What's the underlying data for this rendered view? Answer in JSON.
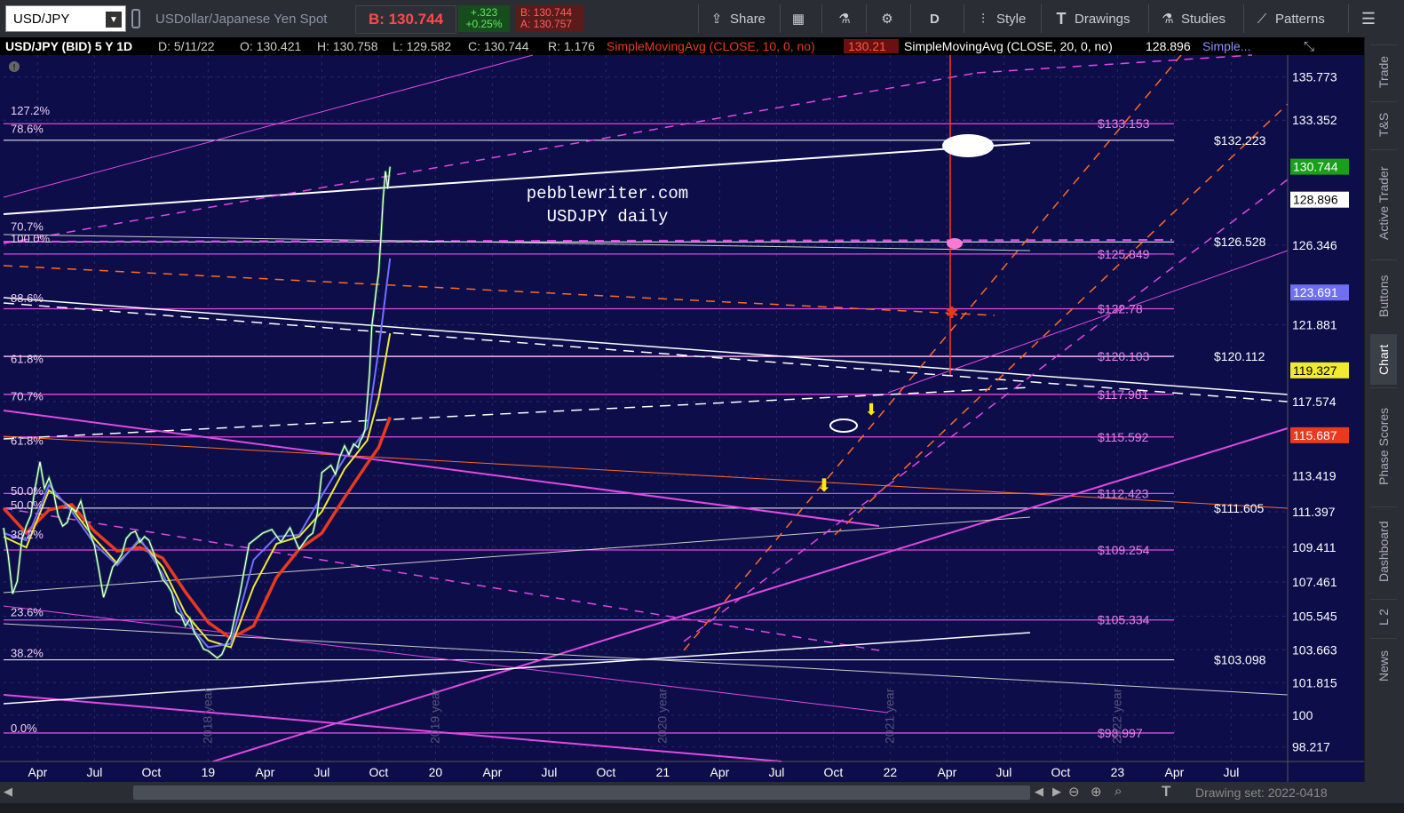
{
  "toolbar": {
    "symbol": "USD/JPY",
    "description": "USDollar/Japanese Yen Spot",
    "bid": "B: 130.744",
    "change_abs": "+.323",
    "change_pct": "+0.25%",
    "bid_small": "B: 130.744",
    "ask_small": "A: 130.757",
    "share": "Share",
    "aggregation": "D",
    "style": "Style",
    "drawings": "Drawings",
    "studies": "Studies",
    "patterns": "Patterns"
  },
  "header": {
    "title": "USD/JPY (BID) 5 Y 1D",
    "date": "D: 5/11/22",
    "open": "O: 130.421",
    "high": "H: 130.758",
    "low": "L: 129.582",
    "close": "C: 130.744",
    "range": "R: 1.176",
    "sma10": "SimpleMovingAvg (CLOSE, 10, 0, no)",
    "sma10_val": "130.21",
    "sma20": "SimpleMovingAvg (CLOSE, 20, 0, no)",
    "sma20_val": "128.896",
    "more": "Simple..."
  },
  "watermark": [
    "pebblewriter.com",
    "USDJPY daily"
  ],
  "side_tabs": [
    "Trade",
    "T&S",
    "Active Trader",
    "Buttons",
    "Chart",
    "Phase Scores",
    "Dashboard",
    "L 2",
    "News"
  ],
  "scrollbar": {
    "drawing_set": "Drawing set: 2022-0418"
  },
  "chart_data": {
    "type": "line",
    "title": "USDJPY daily",
    "ylim": [
      97.4,
      137.0
    ],
    "grid": true,
    "y_ticks": [
      "135.773",
      "133.352",
      "126.346",
      "121.881",
      "117.574",
      "113.419",
      "111.397",
      "109.411",
      "107.461",
      "105.545",
      "103.663",
      "101.815",
      "100",
      "98.217"
    ],
    "x_ticks": [
      "Apr",
      "Jul",
      "Oct",
      "19",
      "Apr",
      "Jul",
      "Oct",
      "20",
      "Apr",
      "Jul",
      "Oct",
      "21",
      "Apr",
      "Jul",
      "Oct",
      "22",
      "Apr",
      "Jul",
      "Oct",
      "23",
      "Apr",
      "Jul"
    ],
    "year_markers": [
      "2018 year",
      "2019 year",
      "2020 year",
      "2021 year",
      "2022 year"
    ],
    "price_badges": [
      {
        "value": "130.744",
        "color": "#18a018"
      },
      {
        "value": "128.896",
        "color": "#ffffff"
      },
      {
        "value": "123.691",
        "color": "#6f6ff0"
      },
      {
        "value": "119.327",
        "color": "#f0ea30"
      },
      {
        "value": "115.687",
        "color": "#e83a1e"
      }
    ],
    "fib_left_labels": [
      {
        "text": "127.2%",
        "price": 133.9
      },
      {
        "text": "78.6%",
        "price": 132.9
      },
      {
        "text": "70.7%",
        "price": 127.4
      },
      {
        "text": "100.0%",
        "price": 126.75
      },
      {
        "text": "88.6%",
        "price": 123.4
      },
      {
        "text": "61.8%",
        "price": 120.0
      },
      {
        "text": "70.7%",
        "price": 117.9
      },
      {
        "text": "61.8%",
        "price": 115.4
      },
      {
        "text": "50.0%",
        "price": 112.6
      },
      {
        "text": "50.0%",
        "price": 111.8
      },
      {
        "text": "38.2%",
        "price": 110.15
      },
      {
        "text": "23.6%",
        "price": 105.8
      },
      {
        "text": "38.2%",
        "price": 103.5
      },
      {
        "text": "0.0%",
        "price": 99.3
      }
    ],
    "levels": [
      {
        "price": 133.153,
        "label": "$133.153",
        "color": "#e04ae0"
      },
      {
        "price": 132.223,
        "label": "$132.223",
        "color": "#ffffff"
      },
      {
        "price": 126.528,
        "label": "$126.528",
        "color": "#ffffff"
      },
      {
        "price": 125.849,
        "label": "$125.849",
        "color": "#e04ae0"
      },
      {
        "price": 122.78,
        "label": "$122.78",
        "color": "#e04ae0"
      },
      {
        "price": 120.103,
        "label": "$120.103",
        "color": "#e04ae0"
      },
      {
        "price": 120.112,
        "label": "$120.112",
        "color": "#ffffff"
      },
      {
        "price": 117.981,
        "label": "$117.981",
        "color": "#e04ae0"
      },
      {
        "price": 115.592,
        "label": "$115.592",
        "color": "#e04ae0"
      },
      {
        "price": 112.423,
        "label": "$112.423",
        "color": "#e04ae0"
      },
      {
        "price": 111.605,
        "label": "$111.605",
        "color": "#ffffff"
      },
      {
        "price": 109.254,
        "label": "$109.254",
        "color": "#e04ae0"
      },
      {
        "price": 105.334,
        "label": "$105.334",
        "color": "#e04ae0"
      },
      {
        "price": 103.098,
        "label": "$103.098",
        "color": "#ffffff"
      },
      {
        "price": 98.997,
        "label": "$98.997",
        "color": "#e04ae0"
      }
    ],
    "series": [
      {
        "name": "USD/JPY",
        "color": "#ffffff",
        "points": [
          [
            0,
            110.5
          ],
          [
            0.02,
            109.0
          ],
          [
            0.04,
            106.8
          ],
          [
            0.06,
            107.5
          ],
          [
            0.08,
            109.8
          ],
          [
            0.1,
            110.6
          ],
          [
            0.12,
            111.2
          ],
          [
            0.14,
            112.8
          ],
          [
            0.16,
            114.2
          ],
          [
            0.18,
            112.7
          ],
          [
            0.2,
            113.3
          ],
          [
            0.22,
            112.5
          ],
          [
            0.24,
            111.2
          ],
          [
            0.26,
            110.6
          ],
          [
            0.28,
            110.8
          ],
          [
            0.3,
            111.6
          ],
          [
            0.32,
            111.4
          ],
          [
            0.34,
            112.0
          ],
          [
            0.36,
            111.0
          ],
          [
            0.38,
            110.2
          ],
          [
            0.4,
            109.5
          ],
          [
            0.42,
            108.1
          ],
          [
            0.44,
            106.6
          ],
          [
            0.46,
            107.4
          ],
          [
            0.48,
            108.3
          ],
          [
            0.5,
            108.6
          ],
          [
            0.52,
            109.0
          ],
          [
            0.54,
            109.9
          ],
          [
            0.56,
            110.2
          ],
          [
            0.58,
            110.3
          ],
          [
            0.6,
            109.7
          ],
          [
            0.62,
            110.0
          ],
          [
            0.64,
            109.8
          ],
          [
            0.66,
            109.1
          ],
          [
            0.68,
            108.3
          ],
          [
            0.7,
            107.6
          ],
          [
            0.72,
            107.3
          ],
          [
            0.74,
            106.9
          ],
          [
            0.76,
            105.8
          ],
          [
            0.78,
            105.6
          ],
          [
            0.8,
            105.0
          ],
          [
            0.82,
            105.4
          ],
          [
            0.84,
            104.6
          ],
          [
            0.86,
            104.2
          ],
          [
            0.88,
            103.7
          ],
          [
            0.9,
            103.6
          ],
          [
            0.92,
            103.4
          ],
          [
            0.94,
            103.2
          ],
          [
            0.96,
            103.4
          ],
          [
            0.98,
            104.0
          ],
          [
            1.0,
            104.5
          ],
          [
            1.04,
            106.8
          ],
          [
            1.08,
            109.6
          ],
          [
            1.1,
            109.8
          ],
          [
            1.14,
            110.2
          ],
          [
            1.18,
            110.4
          ],
          [
            1.22,
            109.7
          ],
          [
            1.26,
            110.5
          ],
          [
            1.3,
            109.3
          ],
          [
            1.34,
            110.0
          ],
          [
            1.36,
            110.2
          ],
          [
            1.38,
            111.3
          ],
          [
            1.4,
            113.6
          ],
          [
            1.42,
            113.8
          ],
          [
            1.44,
            114.0
          ],
          [
            1.46,
            113.5
          ],
          [
            1.48,
            114.5
          ],
          [
            1.5,
            115.1
          ],
          [
            1.52,
            114.6
          ],
          [
            1.54,
            115.2
          ],
          [
            1.56,
            115.0
          ],
          [
            1.57,
            115.4
          ],
          [
            1.58,
            115.6
          ],
          [
            1.59,
            116.0
          ],
          [
            1.6,
            117.6
          ],
          [
            1.61,
            119.2
          ],
          [
            1.62,
            121.8
          ],
          [
            1.63,
            122.8
          ],
          [
            1.64,
            123.9
          ],
          [
            1.65,
            124.8
          ],
          [
            1.66,
            126.8
          ],
          [
            1.67,
            129.0
          ],
          [
            1.68,
            130.5
          ],
          [
            1.69,
            129.5
          ],
          [
            1.7,
            130.744
          ]
        ]
      },
      {
        "name": "SMA 10",
        "color": "#7070ff",
        "points": [
          [
            0,
            110.2
          ],
          [
            0.1,
            109.8
          ],
          [
            0.2,
            112.9
          ],
          [
            0.3,
            111.4
          ],
          [
            0.4,
            109.6
          ],
          [
            0.5,
            108.4
          ],
          [
            0.6,
            109.9
          ],
          [
            0.7,
            107.9
          ],
          [
            0.8,
            105.3
          ],
          [
            0.9,
            103.8
          ],
          [
            1.0,
            104.0
          ],
          [
            1.1,
            108.7
          ],
          [
            1.2,
            110.0
          ],
          [
            1.3,
            110.1
          ],
          [
            1.4,
            112.3
          ],
          [
            1.5,
            114.4
          ],
          [
            1.6,
            116.1
          ],
          [
            1.65,
            120.5
          ],
          [
            1.7,
            125.6
          ]
        ]
      },
      {
        "name": "SMA 20",
        "color": "#f0ea30",
        "points": [
          [
            0,
            110.0
          ],
          [
            0.1,
            109.4
          ],
          [
            0.2,
            112.6
          ],
          [
            0.3,
            111.6
          ],
          [
            0.4,
            109.9
          ],
          [
            0.5,
            108.5
          ],
          [
            0.6,
            109.8
          ],
          [
            0.7,
            108.3
          ],
          [
            0.8,
            105.7
          ],
          [
            0.9,
            104.2
          ],
          [
            1.0,
            103.8
          ],
          [
            1.1,
            107.2
          ],
          [
            1.2,
            109.6
          ],
          [
            1.3,
            110.0
          ],
          [
            1.4,
            111.4
          ],
          [
            1.5,
            113.8
          ],
          [
            1.6,
            115.4
          ],
          [
            1.65,
            117.8
          ],
          [
            1.7,
            121.4
          ]
        ]
      },
      {
        "name": "SMA 50",
        "color": "#e83a1e",
        "points": [
          [
            0,
            111.6
          ],
          [
            0.1,
            110.2
          ],
          [
            0.2,
            111.5
          ],
          [
            0.3,
            111.8
          ],
          [
            0.4,
            110.3
          ],
          [
            0.5,
            109.2
          ],
          [
            0.6,
            109.4
          ],
          [
            0.7,
            108.8
          ],
          [
            0.8,
            106.9
          ],
          [
            0.9,
            105.2
          ],
          [
            1.0,
            104.3
          ],
          [
            1.1,
            105.0
          ],
          [
            1.2,
            107.7
          ],
          [
            1.3,
            109.3
          ],
          [
            1.4,
            110.2
          ],
          [
            1.5,
            112.2
          ],
          [
            1.6,
            114.1
          ],
          [
            1.65,
            115.0
          ],
          [
            1.7,
            116.7
          ]
        ]
      }
    ]
  }
}
